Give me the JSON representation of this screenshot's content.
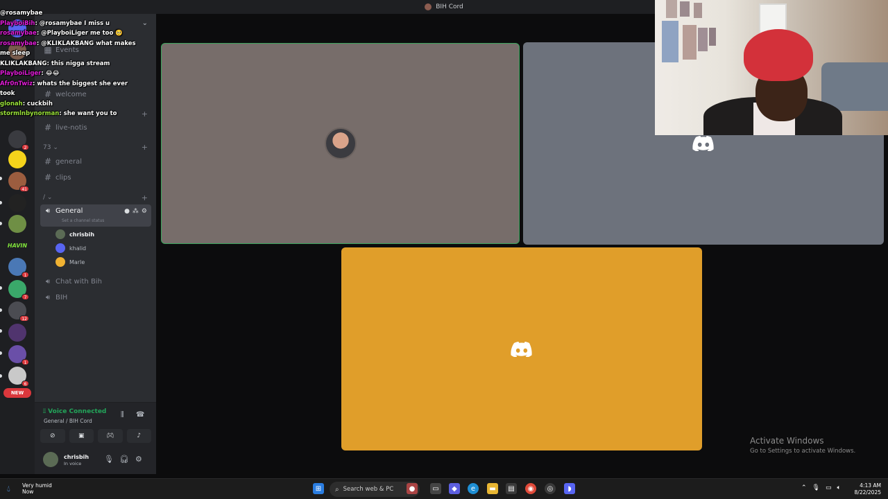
{
  "window": {
    "title": "BIH Cord"
  },
  "servers": {
    "items": [
      {
        "name": "server-1",
        "color": "#5865f2",
        "badge": ""
      },
      {
        "name": "server-2",
        "color": "#7a5c4d",
        "badge": ""
      },
      {
        "name": "server-3",
        "color": "#3a3b40",
        "badge": "2"
      },
      {
        "name": "server-4",
        "color": "#f5d31b",
        "badge": ""
      },
      {
        "name": "server-5",
        "color": "#9c5d3f",
        "badge": "41"
      },
      {
        "name": "server-6",
        "color": "#222222",
        "badge": ""
      },
      {
        "name": "server-7",
        "color": "#6f8f45",
        "badge": ""
      },
      {
        "name": "server-havin",
        "color": "#1e1f22",
        "badge": ""
      },
      {
        "name": "server-9",
        "color": "#4a78b5",
        "badge": "1"
      },
      {
        "name": "server-10",
        "color": "#3aa86a",
        "badge": "7"
      },
      {
        "name": "server-11",
        "color": "#4b4c52",
        "badge": "12"
      },
      {
        "name": "server-12",
        "color": "#50346e",
        "badge": ""
      },
      {
        "name": "server-13",
        "color": "#6a4fa8",
        "badge": "1"
      },
      {
        "name": "server-14",
        "color": "#c9c9c9",
        "badge": "6"
      }
    ],
    "havin_label": "HAVIN",
    "new_label": "NEW"
  },
  "channels": {
    "events": "Events",
    "welcome": "welcome",
    "live_notis": "live-notis",
    "category_1": "73",
    "general_text": "general",
    "clips": "clips",
    "category_2": "/",
    "voice_general": "General",
    "channel_status": "Set a channel status",
    "voice_users": [
      {
        "name": "chrisbih",
        "color": "#5b6b55"
      },
      {
        "name": "khalid",
        "color": "#5865f2"
      },
      {
        "name": "Marle",
        "color": "#f0b232"
      }
    ],
    "chat_with_bih": "Chat with Bih",
    "bih_voice": "BIH"
  },
  "voice": {
    "status": "Voice Connected",
    "location": "General / BIH Cord"
  },
  "user": {
    "name": "chrisbih",
    "status": "In voice"
  },
  "chat_overlay": {
    "messages": [
      {
        "user": "",
        "text": "@rosamybae",
        "user_class": ""
      },
      {
        "user": "PlayboiBih",
        "text": ": @rosamybae I miss u",
        "user_class": "u-pink"
      },
      {
        "user": "rosamybae",
        "text": ": @PlayboiLiger me too 🥺",
        "user_class": "u-pink"
      },
      {
        "user": "rosamybae",
        "text": ": @KLIKLAKBANG what makes",
        "user_class": "u-pink"
      },
      {
        "user": "",
        "text": "me sleep",
        "user_class": ""
      },
      {
        "user": "KLIKLAKBANG",
        "text": ": this nigga stream",
        "user_class": ""
      },
      {
        "user": "PlayboiLiger",
        "text": ": 😂😂",
        "user_class": "u-pink"
      },
      {
        "user": "Afr0nTwiz",
        "text": ": whats the biggest she ever",
        "user_class": "u-pink"
      },
      {
        "user": "",
        "text": "took",
        "user_class": ""
      },
      {
        "user": "glonah",
        "text": ": cuckbih",
        "user_class": "u-lime"
      },
      {
        "user": "stormlnbynorman",
        "text": ": she want you to",
        "user_class": "u-lime"
      }
    ]
  },
  "stage": {
    "tile_a_color": "#776d6a",
    "tile_b_color": "#6d727c",
    "tile_c_color": "#e09e2a"
  },
  "activation": {
    "title": "Activate Windows",
    "subtitle": "Go to Settings to activate Windows."
  },
  "taskbar": {
    "weather_title": "Very humid",
    "weather_sub": "Now",
    "search_placeholder": "Search web & PC",
    "time": "4:13 AM",
    "date": "8/22/2025"
  }
}
